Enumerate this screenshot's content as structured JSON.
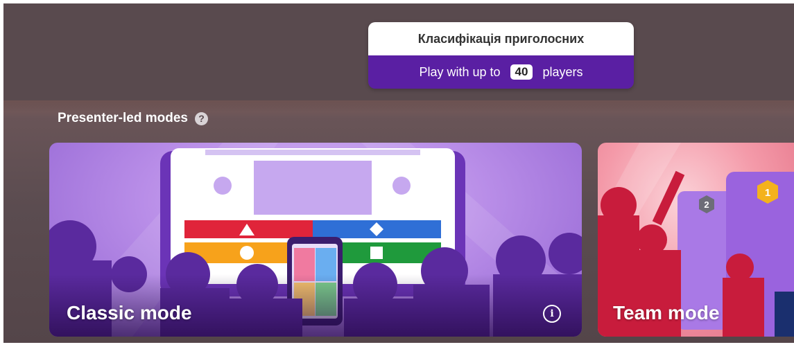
{
  "activity": {
    "title": "Класифікація приголосних",
    "players_prefix": "Play with up to",
    "max_players": "40",
    "players_suffix": "players"
  },
  "section": {
    "label": "Presenter-led modes",
    "help_icon": "question-circle-icon",
    "help_glyph": "?"
  },
  "modes": [
    {
      "title": "Classic mode",
      "info_icon": "info-circle-icon",
      "info_glyph": "i"
    },
    {
      "title": "Team mode"
    }
  ],
  "team_badges": [
    "2",
    "1"
  ],
  "colors": {
    "background": "#594a4e",
    "accent_purple": "#5a1fa3",
    "classic_card": "#b98ee8",
    "team_card": "#f49aa9",
    "answer_red": "#e0243a",
    "answer_blue": "#2f6fd6",
    "answer_yellow": "#f7a21b",
    "answer_green": "#1f9a3c"
  }
}
